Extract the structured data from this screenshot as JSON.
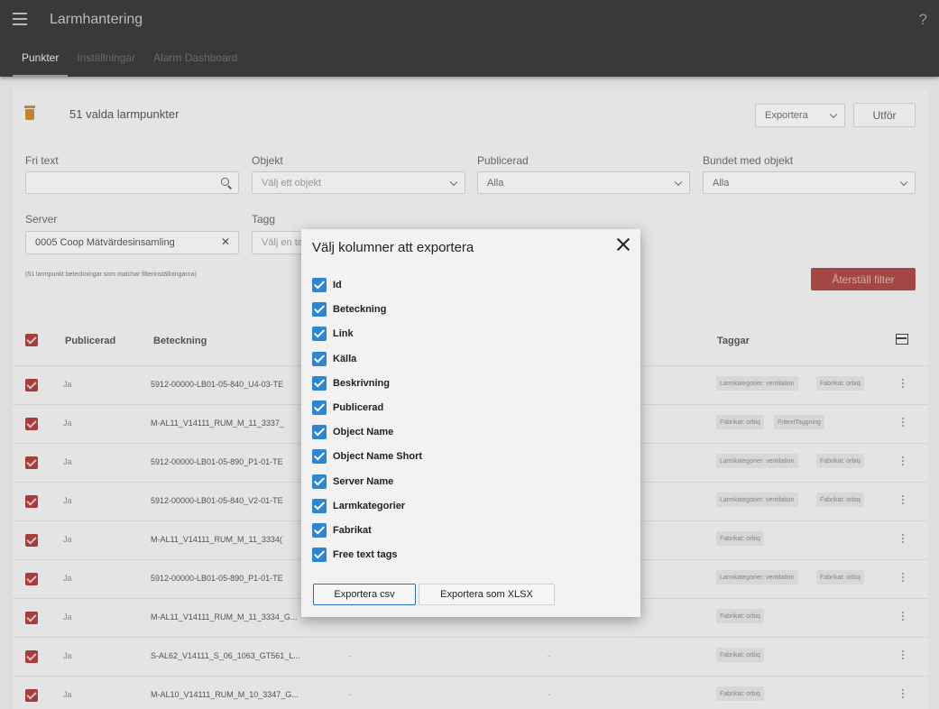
{
  "app": {
    "title": "Larmhantering",
    "help": "?"
  },
  "tabs": [
    {
      "label": "Punkter",
      "active": true
    },
    {
      "label": "Inställningar",
      "active": false
    },
    {
      "label": "Alarm Dashboard",
      "active": false
    }
  ],
  "toolbar": {
    "selected_text": "51 valda larmpunkter",
    "action_select_value": "Exportera",
    "run_button": "Utför"
  },
  "filters": {
    "fritext": {
      "label": "Fri text",
      "value": ""
    },
    "objekt": {
      "label": "Objekt",
      "placeholder": "Välj ett objekt"
    },
    "publicerad": {
      "label": "Publicerad",
      "value": "Alla"
    },
    "bundet": {
      "label": "Bundet med objekt",
      "value": "Alla"
    },
    "server": {
      "label": "Server",
      "value": "0005 Coop Mätvärdesinsamling"
    },
    "tagg": {
      "label": "Tagg",
      "placeholder": "Välj en tag"
    },
    "match_info": "(51 larmpunkt beteckningar som matchar filterinställningarna)",
    "reset_button": "Återställ filter"
  },
  "table": {
    "headers": {
      "publicerad": "Publicerad",
      "beteckning": "Beteckning",
      "taggar": "Taggar"
    },
    "rows": [
      {
        "pub": "Ja",
        "bet": "5912-00000-LB01-05-840_U4-03-TE",
        "tags": [
          "Larmkategorier: ventilation",
          "Fabrikat: orbiq"
        ]
      },
      {
        "pub": "Ja",
        "bet": "M-AL11_V14111_RUM_M_11_3337_",
        "tags": [
          "Fabrikat: orbiq",
          "FritextTaggning"
        ]
      },
      {
        "pub": "Ja",
        "bet": "5912-00000-LB01-05-890_P1-01-TE",
        "tags": [
          "Larmkategorier: ventilation",
          "Fabrikat: orbiq"
        ]
      },
      {
        "pub": "Ja",
        "bet": "5912-00000-LB01-05-840_V2-01-TE",
        "tags": [
          "Larmkategorier: ventilation",
          "Fabrikat: orbiq"
        ]
      },
      {
        "pub": "Ja",
        "bet": "M-AL11_V14111_RUM_M_11_3334(",
        "tags": [
          "Fabrikat: orbiq"
        ]
      },
      {
        "pub": "Ja",
        "bet": "5912-00000-LB01-05-890_P1-01-TE",
        "tags": [
          "Larmkategorier: ventilation",
          "Fabrikat: orbiq"
        ]
      },
      {
        "pub": "Ja",
        "bet": "M-AL11_V14111_RUM_M_11_3334_G...",
        "tags": [
          "Fabrikat: orbiq"
        ]
      },
      {
        "pub": "Ja",
        "bet": "S-AL62_V14111_S_06_1063_GT561_L...",
        "c1": "-",
        "c2": "-",
        "tags": [
          "Fabrikat: orbiq"
        ]
      },
      {
        "pub": "Ja",
        "bet": "M-AL10_V14111_RUM_M_10_3347_G...",
        "c1": "-",
        "c2": "-",
        "tags": [
          "Fabrikat: orbiq"
        ]
      }
    ]
  },
  "dialog": {
    "title": "Välj kolumner att exportera",
    "options": [
      "Id",
      "Beteckning",
      "Link",
      "Källa",
      "Beskrivning",
      "Publicerad",
      "Object Name",
      "Object Name Short",
      "Server Name",
      "Larmkategorier",
      "Fabrikat",
      "Free text tags"
    ],
    "csv_button": "Exportera csv",
    "xlsx_button": "Exportera som XLSX"
  },
  "colors": {
    "accent": "#a9413f",
    "checkbox_blue": "#2e86d1",
    "appbar": "#3b3b3b"
  }
}
